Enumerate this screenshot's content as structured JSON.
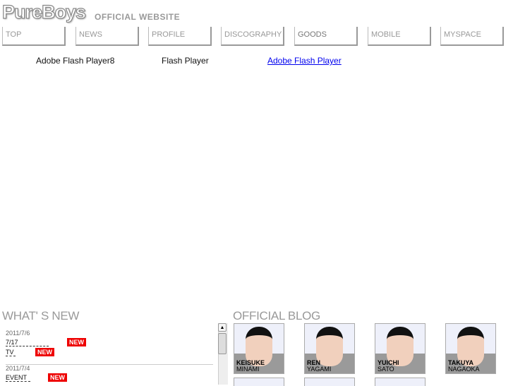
{
  "header": {
    "logo": "PureBoys",
    "subtitle": "OFFICIAL WEBSITE"
  },
  "nav": [
    "TOP",
    "NEWS",
    "PROFILE",
    "DISCOGRAPHY",
    "GOODS",
    "MOBILE",
    "MYSPACE"
  ],
  "flash": {
    "text1": "Adobe Flash Player8",
    "text2": "Flash Player",
    "link": "Adobe Flash Player"
  },
  "whats_new": {
    "title": "WHAT' S NEW",
    "badge": "NEW",
    "entries": [
      {
        "date": "2011/7/6",
        "items": [
          "7/17",
          "TV"
        ]
      },
      {
        "date": "2011/7/4",
        "items": [
          "EVENT"
        ]
      }
    ]
  },
  "blog": {
    "title": "OFFICIAL BLOG",
    "members": [
      {
        "first": "KEISUKE",
        "last": "MINAMI"
      },
      {
        "first": "REN",
        "last": "YAGAMI"
      },
      {
        "first": "YUICHI",
        "last": "SATO"
      },
      {
        "first": "TAKUYA",
        "last": "NAGAOKA"
      }
    ]
  }
}
